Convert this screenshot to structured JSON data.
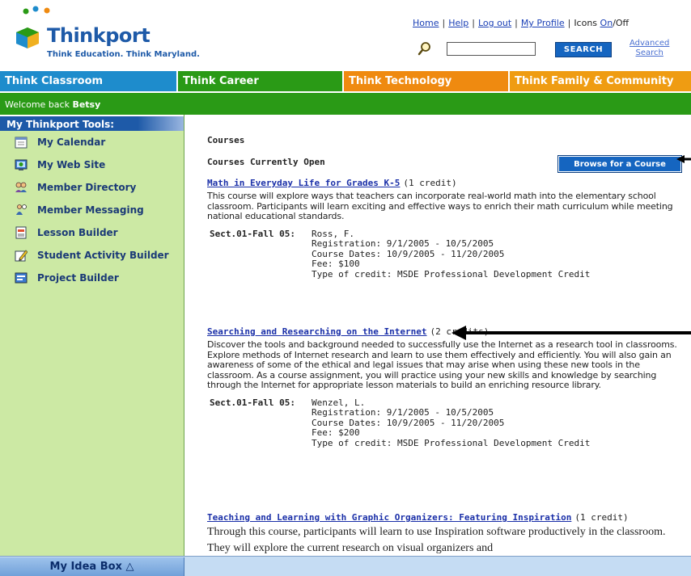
{
  "header": {
    "logo_name": "Thinkport",
    "logo_tagline": "Think Education. Think Maryland.",
    "links": [
      {
        "label": "Home"
      },
      {
        "label": "Help"
      },
      {
        "label": "Log out"
      },
      {
        "label": "My Profile"
      }
    ],
    "icons_text": "Icons",
    "icons_on": "On",
    "icons_off": "/Off",
    "search_placeholder": "",
    "search_button": "SEARCH",
    "advanced_search_line1": "Advanced",
    "advanced_search_line2": "Search"
  },
  "nav": {
    "tabs": [
      {
        "label": "Think Classroom",
        "color": "#1e8ccc"
      },
      {
        "label": "Think Career",
        "color": "#2a9a16"
      },
      {
        "label": "Think Technology",
        "color": "#ef8a10"
      },
      {
        "label": "Think Family & Community",
        "color": "#ef9c12"
      }
    ]
  },
  "welcome": {
    "prefix": "Welcome back ",
    "name": "Betsy"
  },
  "sidebar": {
    "header": "My Thinkport Tools:",
    "items": [
      {
        "label": "My Calendar",
        "icon": "calendar-icon"
      },
      {
        "label": "My Web Site",
        "icon": "website-icon"
      },
      {
        "label": "Member Directory",
        "icon": "directory-icon"
      },
      {
        "label": "Member Messaging",
        "icon": "messaging-icon"
      },
      {
        "label": "Lesson Builder",
        "icon": "lesson-icon"
      },
      {
        "label": "Student Activity Builder",
        "icon": "pencil-icon"
      },
      {
        "label": "Project Builder",
        "icon": "project-icon"
      }
    ]
  },
  "main": {
    "page_title": "Courses",
    "section_title": "Courses Currently Open",
    "browse_button": "Browse for a Course",
    "courses": [
      {
        "title": "Math in Everyday Life for Grades K-5",
        "credit": "(1 credit)",
        "description": "This course will explore ways that teachers can incorporate real-world math into the elementary school classroom. Participants will learn exciting and effective ways to enrich their math curriculum while meeting national educational standards.",
        "section": "Sect.01-Fall 05:",
        "instructor": "Ross, F.",
        "registration": "Registration: 9/1/2005 - 10/5/2005",
        "dates": "Course Dates: 10/9/2005 - 11/20/2005",
        "fee": "Fee: $100",
        "credit_type": "Type of credit: MSDE Professional Development Credit"
      },
      {
        "title": "Searching and Researching on the Internet",
        "credit": "(2 credits)",
        "description": "Discover the tools and background needed to successfully use the Internet as a research tool in classrooms. Explore methods of Internet research and learn to use them effectively and efficiently. You will also gain an awareness of some of the ethical and legal issues that may arise when using these new tools in the classroom. As a course assignment, you will practice using your new skills and knowledge by searching through the Internet for appropriate lesson materials to build an enriching resource library.",
        "section": "Sect.01-Fall 05:",
        "instructor": "Wenzel, L.",
        "registration": "Registration: 9/1/2005 - 10/5/2005",
        "dates": "Course Dates: 10/9/2005 - 11/20/2005",
        "fee": "Fee: $200",
        "credit_type": "Type of credit: MSDE Professional Development Credit"
      },
      {
        "title": "Teaching and Learning with Graphic Organizers: Featuring Inspiration",
        "credit": "(1 credit)",
        "description": "Through this course, participants will learn to use Inspiration software productively in the classroom. They will explore the current research on visual organizers and"
      }
    ]
  },
  "footer": {
    "idea_box": "My Idea Box △"
  }
}
